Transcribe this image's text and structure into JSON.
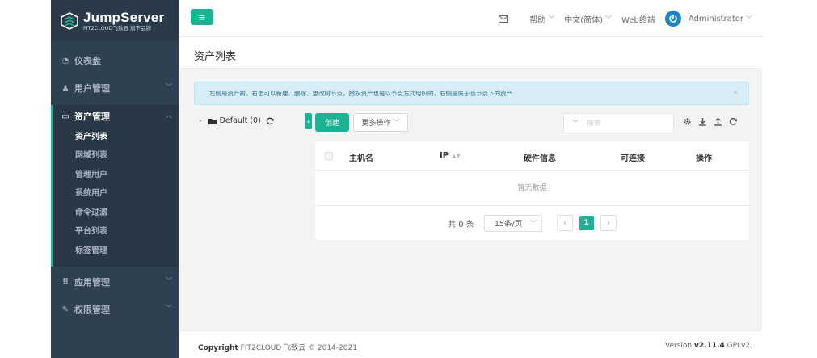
{
  "brand": {
    "title": "JumpServer",
    "subtitle": "FIT2CLOUD飞致云 旗下品牌",
    "accent": "#1ab394"
  },
  "sidebar": {
    "items": [
      {
        "label": "仪表盘",
        "icon": "dashboard-icon"
      },
      {
        "label": "用户管理",
        "icon": "users-icon"
      },
      {
        "label": "资产管理",
        "icon": "inbox-icon"
      },
      {
        "label": "应用管理",
        "icon": "grid-icon"
      },
      {
        "label": "权限管理",
        "icon": "edit-icon"
      }
    ],
    "asset_sub": [
      "资产列表",
      "网域列表",
      "管理用户",
      "系统用户",
      "命令过滤",
      "平台列表",
      "标签管理"
    ]
  },
  "topbar": {
    "menu_glyph": "≡",
    "help": "帮助",
    "language": "中文(简体)",
    "web_terminal": "Web终端",
    "user": "Administrator"
  },
  "page": {
    "title": "资产列表"
  },
  "alert": {
    "text": "左侧是资产树，右击可以新建、删除、更改树节点，授权资产也是以节点方式组织的，右侧是属于该节点下的资产",
    "close": "×"
  },
  "tree": {
    "node": "Default (0)"
  },
  "toolbar": {
    "collapse": "‹",
    "create": "创建",
    "more": "更多操作",
    "search_placeholder": "搜索"
  },
  "table": {
    "headers": {
      "hostname": "主机名",
      "ip": "IP",
      "hardware": "硬件信息",
      "connectivity": "可连接",
      "actions": "操作"
    },
    "empty": "暂无数据"
  },
  "pagination": {
    "total": "共 0 条",
    "page_size": "15条/页",
    "prev": "‹",
    "next": "›",
    "current": "1"
  },
  "footer": {
    "copyright_label": "Copyright",
    "copyright_text": "FIT2CLOUD 飞致云 © 2014-2021",
    "version_label": "Version",
    "version": "v2.11.4",
    "license": "GPLv2."
  }
}
